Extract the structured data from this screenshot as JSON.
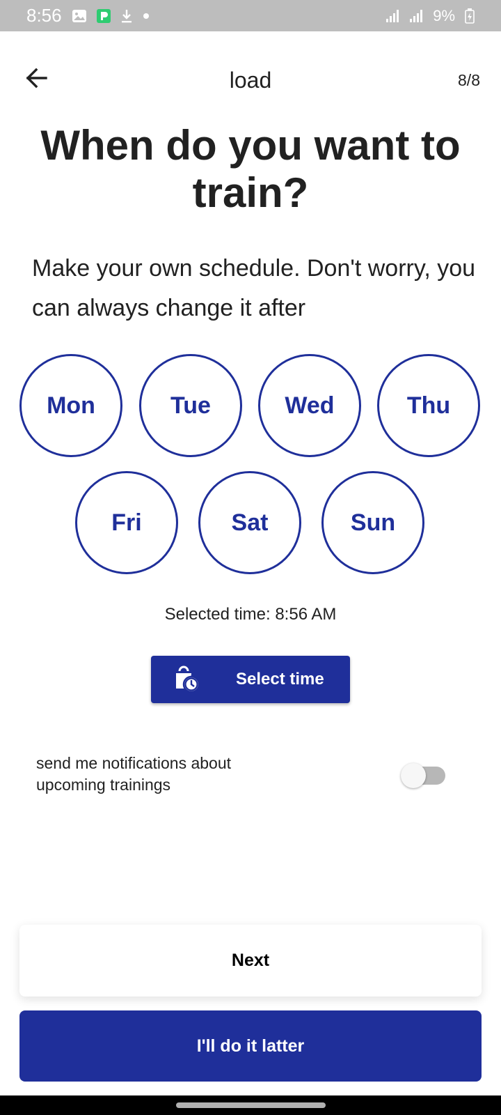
{
  "status_bar": {
    "time": "8:56",
    "battery": "9%",
    "icons": [
      "gallery-icon",
      "app-icon",
      "download-icon",
      "dot-icon",
      "signal-icon",
      "signal-icon",
      "battery-icon"
    ]
  },
  "app_bar": {
    "title": "load",
    "step": "8/8"
  },
  "headline": "When do you want to train?",
  "subtitle": "Make your own schedule. Don't worry, you can always change it after",
  "days": [
    "Mon",
    "Tue",
    "Wed",
    "Thu",
    "Fri",
    "Sat",
    "Sun"
  ],
  "selected_time": "Selected time: 8:56 AM",
  "select_time_button": "Select time",
  "notifications": {
    "label": "send me notifications about\n upcoming trainings",
    "enabled": false
  },
  "next_button": "Next",
  "later_button": "I'll do it latter",
  "colors": {
    "accent": "#1f2f9a",
    "status_bar": "#bdbdbd"
  }
}
